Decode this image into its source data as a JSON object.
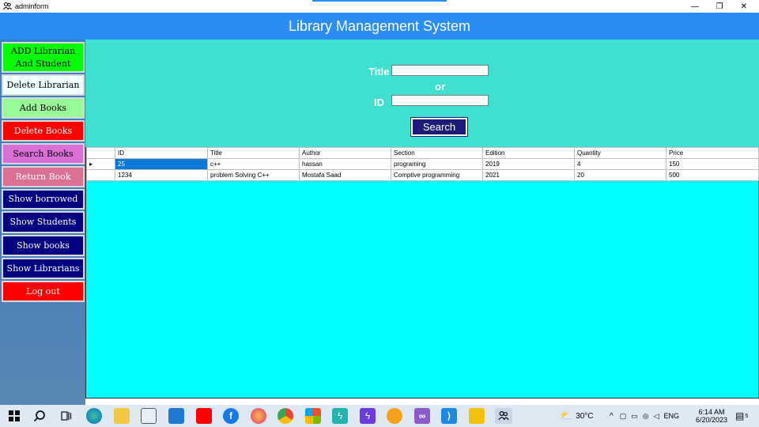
{
  "window": {
    "title": "adminform",
    "minimize": "—",
    "restore": "❐",
    "close": "✕"
  },
  "header": {
    "title": "Library Management System"
  },
  "sidebar": {
    "items": [
      {
        "label_line1": "ADD Librarian",
        "label_line2": "And Student",
        "bg": "#00ff00",
        "fg": "#000000"
      },
      {
        "label": "Delete Librarian",
        "bg": "#f0ffff",
        "fg": "#000000"
      },
      {
        "label": "Add Books",
        "bg": "#98fb98",
        "fg": "#000000"
      },
      {
        "label": "Delete Books",
        "bg": "#ff0000",
        "fg": "#ffffff"
      },
      {
        "label": "Search Books",
        "bg": "#da70d6",
        "fg": "#000000"
      },
      {
        "label": "Return Book",
        "bg": "#db7093",
        "fg": "#ffffff"
      },
      {
        "label": "Show borrowed",
        "bg": "#000080",
        "fg": "#ffffff"
      },
      {
        "label": "Show Students",
        "bg": "#000080",
        "fg": "#ffffff"
      },
      {
        "label": "Show books",
        "bg": "#000080",
        "fg": "#ffffff"
      },
      {
        "label": "Show Librarians",
        "bg": "#000080",
        "fg": "#ffffff"
      },
      {
        "label": "Log out",
        "bg": "#ff0000",
        "fg": "#ffffff"
      }
    ]
  },
  "search": {
    "title_label": "Title",
    "or_label": "or",
    "id_label": "ID",
    "title_value": "",
    "id_value": "",
    "button_label": "Search"
  },
  "grid": {
    "columns": [
      "ID",
      "Title",
      "Author",
      "Section",
      "Edition",
      "Quantity",
      "Price"
    ],
    "rows": [
      [
        "25",
        "c++",
        "hassan",
        "programing",
        "2019",
        "4",
        "150"
      ],
      [
        "1234",
        "problem Solving C++",
        " Mostafa Saad",
        "Comptive programming",
        "2021",
        "20",
        "500"
      ]
    ],
    "current_row_marker": "▸"
  },
  "taskbar": {
    "weather": "30°C",
    "language": "ENG",
    "time": "6:14 AM",
    "date": "6/20/2023",
    "notifications": "5"
  },
  "colors": {
    "header": "#2b8cf2",
    "panel": "#40e0d0",
    "grid_bg": "#00ffff",
    "search_button": "#1c1c78"
  }
}
